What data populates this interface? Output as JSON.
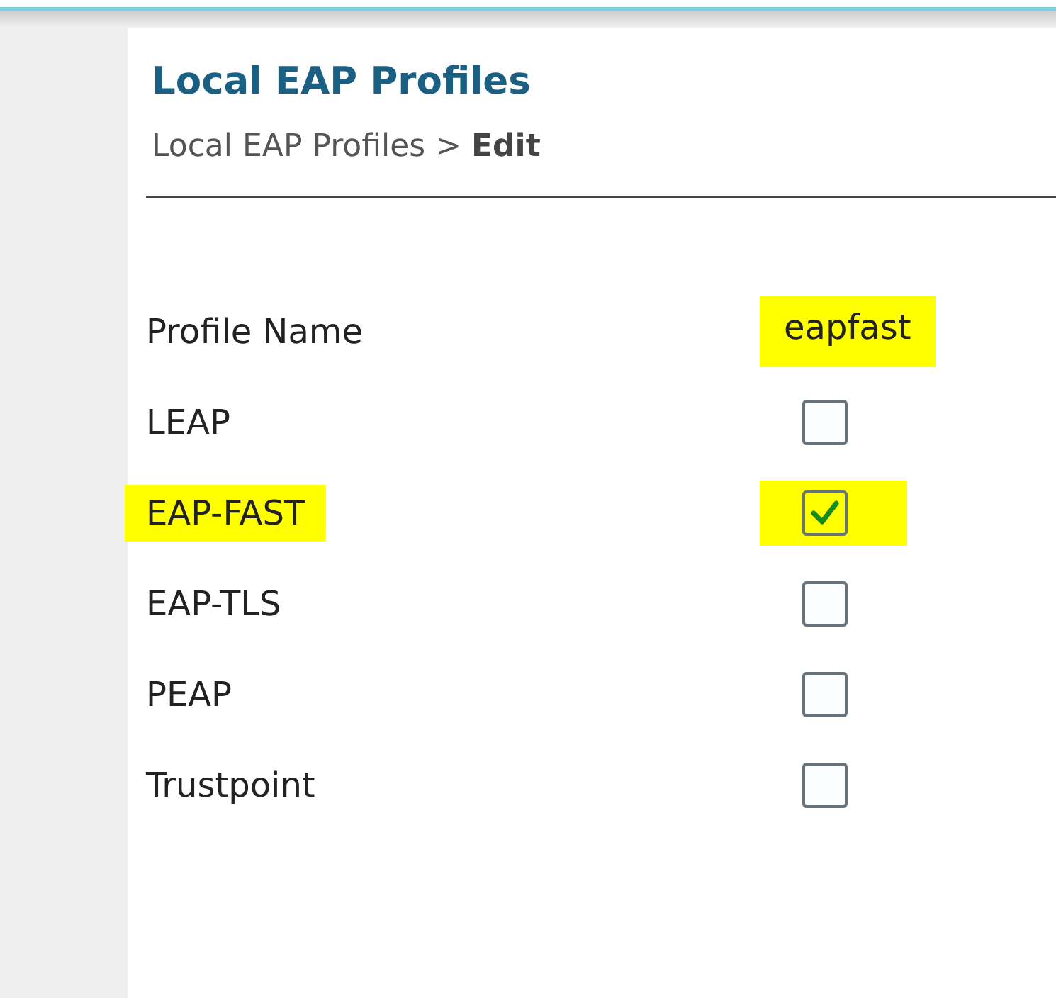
{
  "page": {
    "title": "Local EAP Profiles",
    "breadcrumb": "Local EAP Profiles > **Edit**"
  },
  "fields": [
    {
      "kind": "text",
      "label": "Profile Name",
      "value": "eapfast",
      "label_highlighted": false,
      "value_highlighted": true
    },
    {
      "kind": "checkbox",
      "label": "LEAP",
      "checked": false,
      "label_highlighted": false,
      "value_highlighted": false
    },
    {
      "kind": "checkbox",
      "label": "EAP-FAST",
      "checked": true,
      "label_highlighted": true,
      "value_highlighted": true
    },
    {
      "kind": "checkbox",
      "label": "EAP-TLS",
      "checked": false,
      "label_highlighted": false,
      "value_highlighted": false
    },
    {
      "kind": "checkbox",
      "label": "PEAP",
      "checked": false,
      "label_highlighted": false,
      "value_highlighted": false
    },
    {
      "kind": "checkbox",
      "label": "Trustpoint",
      "checked": false,
      "label_highlighted": false,
      "value_highlighted": false
    }
  ]
}
